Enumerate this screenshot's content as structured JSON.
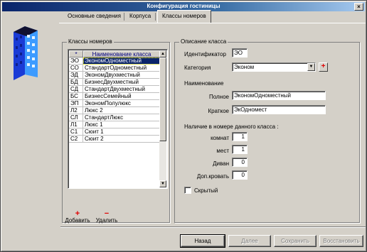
{
  "window": {
    "title": "Конфигурация гостиницы",
    "close_glyph": "×"
  },
  "tabs": [
    {
      "label": "Основные сведения"
    },
    {
      "label": "Корпуса"
    },
    {
      "label": "Классы номеров"
    }
  ],
  "classes_group": {
    "legend": "Классы номеров",
    "columns": [
      "*",
      "Наименование класса"
    ],
    "rows": [
      {
        "code": "ЭО",
        "name": "ЭкономОдноместный"
      },
      {
        "code": "СО",
        "name": "СтандартОдноместный"
      },
      {
        "code": "ЭД",
        "name": "ЭкономДвухместный"
      },
      {
        "code": "БД",
        "name": "БизнесДвухместный"
      },
      {
        "code": "СД",
        "name": "СтандартДвухместный"
      },
      {
        "code": "БС",
        "name": "БизнесСемейный"
      },
      {
        "code": "ЭП",
        "name": "ЭкономПолулюкс"
      },
      {
        "code": "Л2",
        "name": "Люкс 2"
      },
      {
        "code": "СЛ",
        "name": "СтандартЛюкс"
      },
      {
        "code": "Л1",
        "name": "Люкс 1"
      },
      {
        "code": "С1",
        "name": "Сюит 1"
      },
      {
        "code": "С2",
        "name": "Сюит 2"
      }
    ],
    "selected_index": 0
  },
  "description": {
    "legend": "Описание класса",
    "id_label": "Идентификатор",
    "id_value": "ЭО",
    "category_label": "Категория",
    "category_value": "Эконом",
    "name_heading": "Наименование",
    "full_label": "Полное",
    "full_value": "ЭкономОдноместный",
    "short_label": "Краткое",
    "short_value": "ЭкОдномест",
    "presence_heading": "Наличие в номере данного класса :",
    "rooms_label": "комнат",
    "rooms_value": "1",
    "places_label": "мест",
    "places_value": "1",
    "sofa_label": "Диван",
    "sofa_value": "0",
    "extrabed_label": "Доп.кровать",
    "extrabed_value": "0",
    "hidden_label": "Скрытый",
    "hidden_checked": false
  },
  "toolbar": {
    "add_label": "Добавить",
    "delete_label": "Удалить",
    "add_glyph": "+",
    "delete_glyph": "−"
  },
  "buttons": {
    "back": "Назад",
    "next": "Далее",
    "save": "Сохранить",
    "restore": "Восстановить"
  },
  "icons": {
    "logo": "building-icon",
    "dropdown": "chevron-down-icon",
    "add_category": "plus-icon"
  }
}
